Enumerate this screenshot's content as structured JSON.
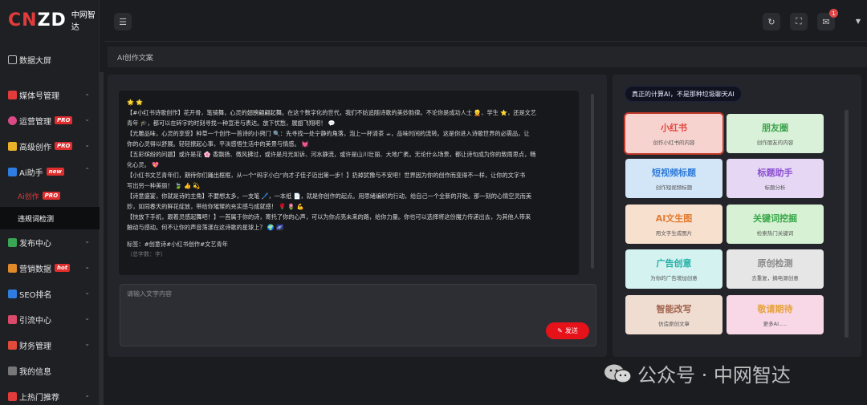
{
  "app": {
    "logo_big_cn": "CN",
    "logo_big_zd": "ZD",
    "logo_small": "中网智达"
  },
  "sidebar": {
    "top_item": "数据大屏",
    "items": [
      {
        "label": "媒体号管理",
        "icon": "media-icon",
        "color": "#e23b3b",
        "badge": ""
      },
      {
        "label": "运营管理",
        "icon": "ops-icon",
        "color": "#d94a86",
        "badge": "PRO"
      },
      {
        "label": "高级创作",
        "icon": "create-icon",
        "color": "#e8b128",
        "badge": "PRO"
      },
      {
        "label": "Ai助手",
        "icon": "ai-icon",
        "color": "#2f7de1",
        "badge": "new"
      }
    ],
    "sub_items": [
      {
        "label": "Ai创作",
        "badge": "PRO"
      },
      {
        "label": "违规词检测",
        "badge": ""
      }
    ],
    "bottom_items": [
      {
        "label": "发布中心",
        "icon": "publish-icon",
        "color": "#3aa655"
      },
      {
        "label": "营销数据",
        "icon": "marketing-icon",
        "color": "#e08a2a",
        "badge": "hot"
      },
      {
        "label": "SEO排名",
        "icon": "seo-icon",
        "color": "#2f7de1"
      },
      {
        "label": "引流中心",
        "icon": "traffic-icon",
        "color": "#d94a6b"
      },
      {
        "label": "财务管理",
        "icon": "finance-icon",
        "color": "#e24b3b"
      },
      {
        "label": "我的信息",
        "icon": "user-icon",
        "color": "#777"
      },
      {
        "label": "上热门推荐",
        "icon": "hot-icon",
        "color": "#e23b3b"
      }
    ]
  },
  "topbar": {
    "notification_count": "1"
  },
  "breadcrumb": "AI创作文案",
  "content": {
    "lines": [
      "🌟 🌟",
      "【#小红书诗歌创作】花开骨，笔骑舞，心灵的翅膀翩翩起舞。在这个数字化的世代，我们不妨追随诗歌的美妙韵律。不论你是成功人士 👱、学生 ⭐，还是文艺",
      "青年 🎓，都可以在碎字的时刻寻找一种宣泄与表达。放下忧愁，展翅飞翔吧！ 💬",
      "【光雕品味，心灵的享受】种草一个创作一首诗的小窍门 🔍：先寻找一处宁静的角落，泡上一杯清茶 ☕，品味时间的流转。这是你进入诗歌世界的必需品，让",
      "你的心灵得以舒展。轻轻撩起心事，平淡感悟生活中的美景与情感。 💓",
      "【五彩缤纷的问题】或许是花 🌸 香飘扬、微风拂过，或许是月光如诉、河水静流，或许是山川壮丽、大地广袤。无论什么场景，都让诗句成为你的致雨思点，畅",
      "化心灵。 💖",
      "【小红书文艺青年们，期待你们踊出框框，从一个“码字小白”向才子佳子迈出第一步！】扔掉犹豫与不安吧！世界因为你的创作而变得不一样，让你的文字书",
      "写出另一种美丽！ 🍃 👍 💫",
      "【诗意盛宴，你就是诗的主角】不要想太多，一支笔 🖊️，一本纸 📄，就是你创作的起点。用思绪编织的行动，给自己一个全新的开始。那一刻的心情空灵而美",
      "妙，如同春天的鲜花绽放，带给你璀璨的充实感与成就感！ 🌹 🌷 💪",
      "【快放下手机，跟着灵感起舞吧！】一首属于你的诗，寄托了你的心声，可以为你点亮未来的路，给你力量。你也可以选择将这份魔力传递出去，为其他人带来",
      "触动与感动。何不让你的声音荡漾在这诗歌的星球上？ 🌍 🌌"
    ],
    "tags": "标签：#创意诗#小红书创作#文艺青年",
    "count": "（总字数：字）"
  },
  "input": {
    "placeholder": "请输入文字内容",
    "send_label": "发送"
  },
  "right": {
    "tagline": "真正的计算AI，不是那种垃圾聊天AI",
    "cards": [
      {
        "title": "小红书",
        "sub": "创作小红书的内容",
        "bg": "#f7d3d0",
        "fg": "#e2483f",
        "sel": true
      },
      {
        "title": "朋友圈",
        "sub": "创作朋友的内容",
        "bg": "#d9f0d9",
        "fg": "#3ea54e"
      },
      {
        "title": "短视频标题",
        "sub": "创作短视频标题",
        "bg": "#d3e6f8",
        "fg": "#2f7bd9"
      },
      {
        "title": "标题助手",
        "sub": "标题分析",
        "bg": "#e6d8f4",
        "fg": "#8a4dd0"
      },
      {
        "title": "AI文生图",
        "sub": "用文字生成图片",
        "bg": "#f8e0cf",
        "fg": "#e27a2f"
      },
      {
        "title": "关键词挖掘",
        "sub": "检索热门关键词",
        "bg": "#d7f1d5",
        "fg": "#3aa84a"
      },
      {
        "title": "广告创意",
        "sub": "为你的广告增加创意",
        "bg": "#d3f2f0",
        "fg": "#24b0a6"
      },
      {
        "title": "原创检测",
        "sub": "去重复，摘电源创意",
        "bg": "#e6e6e6",
        "fg": "#8a8a8a"
      },
      {
        "title": "智能改写",
        "sub": "仿造原创文章",
        "bg": "#efddd2",
        "fg": "#a0624a"
      },
      {
        "title": "敬请期待",
        "sub": "更多AI.....",
        "bg": "#f8d7e6",
        "fg": "#e8a23a"
      }
    ]
  },
  "watermark": {
    "text": "公众号 · 中网智达"
  }
}
